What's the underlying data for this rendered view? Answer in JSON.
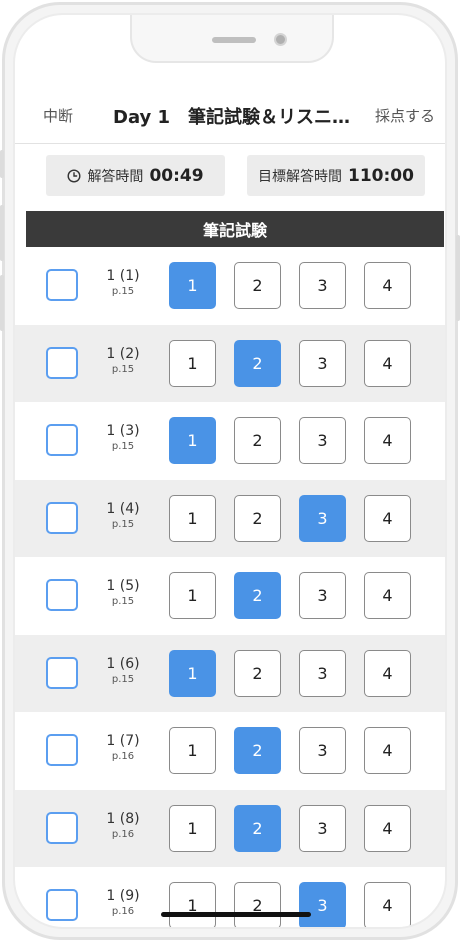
{
  "nav": {
    "left": "中断",
    "title": "Day 1　筆記試験＆リスニ…",
    "right": "採点する"
  },
  "timers": {
    "elapsed_label": "解答時間",
    "elapsed_value": "00:49",
    "target_label": "目標解答時間",
    "target_value": "110:00"
  },
  "section": {
    "title": "筆記試験"
  },
  "options": [
    "1",
    "2",
    "3",
    "4"
  ],
  "questions": [
    {
      "num": "1 (1)",
      "page": "p.15",
      "selected": 1
    },
    {
      "num": "1 (2)",
      "page": "p.15",
      "selected": 2
    },
    {
      "num": "1 (3)",
      "page": "p.15",
      "selected": 1
    },
    {
      "num": "1 (4)",
      "page": "p.15",
      "selected": 3
    },
    {
      "num": "1 (5)",
      "page": "p.15",
      "selected": 2
    },
    {
      "num": "1 (6)",
      "page": "p.15",
      "selected": 1
    },
    {
      "num": "1 (7)",
      "page": "p.16",
      "selected": 2
    },
    {
      "num": "1 (8)",
      "page": "p.16",
      "selected": 2
    },
    {
      "num": "1 (9)",
      "page": "p.16",
      "selected": 3
    }
  ],
  "colors": {
    "accent": "#4a93e6",
    "checkbox_border": "#5b9ef0",
    "section_bg": "#3a3a3a",
    "alt_row": "#eeeeee"
  }
}
